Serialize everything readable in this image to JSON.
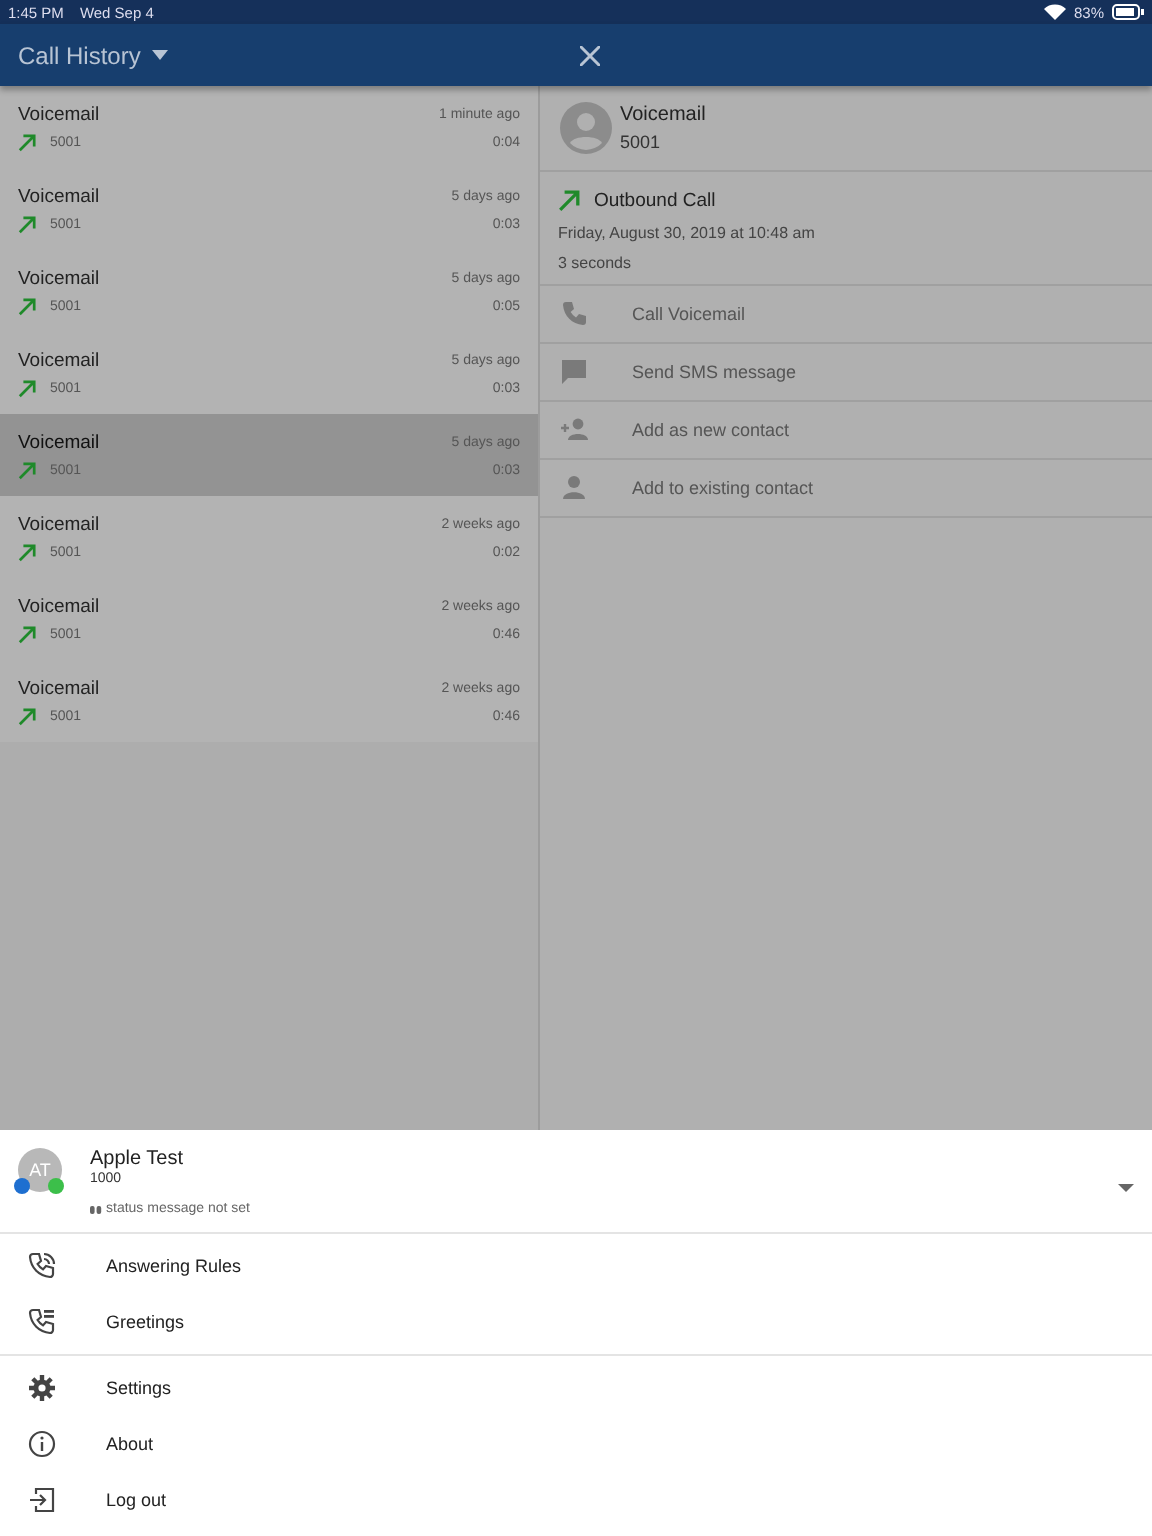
{
  "status_bar": {
    "time": "1:45 PM",
    "date": "Wed Sep 4",
    "battery": "83%"
  },
  "header": {
    "title": "Call History"
  },
  "calls": [
    {
      "name": "Voicemail",
      "number": "5001",
      "when": "1 minute ago",
      "duration": "0:04",
      "selected": false
    },
    {
      "name": "Voicemail",
      "number": "5001",
      "when": "5 days ago",
      "duration": "0:03",
      "selected": false
    },
    {
      "name": "Voicemail",
      "number": "5001",
      "when": "5 days ago",
      "duration": "0:05",
      "selected": false
    },
    {
      "name": "Voicemail",
      "number": "5001",
      "when": "5 days ago",
      "duration": "0:03",
      "selected": false
    },
    {
      "name": "Voicemail",
      "number": "5001",
      "when": "5 days ago",
      "duration": "0:03",
      "selected": true
    },
    {
      "name": "Voicemail",
      "number": "5001",
      "when": "2 weeks ago",
      "duration": "0:02",
      "selected": false
    },
    {
      "name": "Voicemail",
      "number": "5001",
      "when": "2 weeks ago",
      "duration": "0:46",
      "selected": false
    },
    {
      "name": "Voicemail",
      "number": "5001",
      "when": "2 weeks ago",
      "duration": "0:46",
      "selected": false
    }
  ],
  "detail": {
    "name": "Voicemail",
    "number": "5001",
    "direction": "Outbound Call",
    "date": "Friday, August 30, 2019 at 10:48 am",
    "length": "3 seconds",
    "actions": [
      {
        "kind": "phone",
        "label": "Call Voicemail"
      },
      {
        "kind": "message",
        "label": "Send SMS message"
      },
      {
        "kind": "add-person",
        "label": "Add as new contact"
      },
      {
        "kind": "person",
        "label": "Add to existing contact"
      }
    ]
  },
  "drawer": {
    "user": {
      "initials": "AT",
      "name": "Apple Test",
      "extension": "1000",
      "status": "status message not set"
    },
    "groups": [
      [
        {
          "kind": "rules",
          "label": "Answering Rules"
        },
        {
          "kind": "greetings",
          "label": "Greetings"
        }
      ],
      [
        {
          "kind": "gear",
          "label": "Settings"
        },
        {
          "kind": "info",
          "label": "About"
        },
        {
          "kind": "logout",
          "label": "Log out"
        }
      ]
    ]
  }
}
